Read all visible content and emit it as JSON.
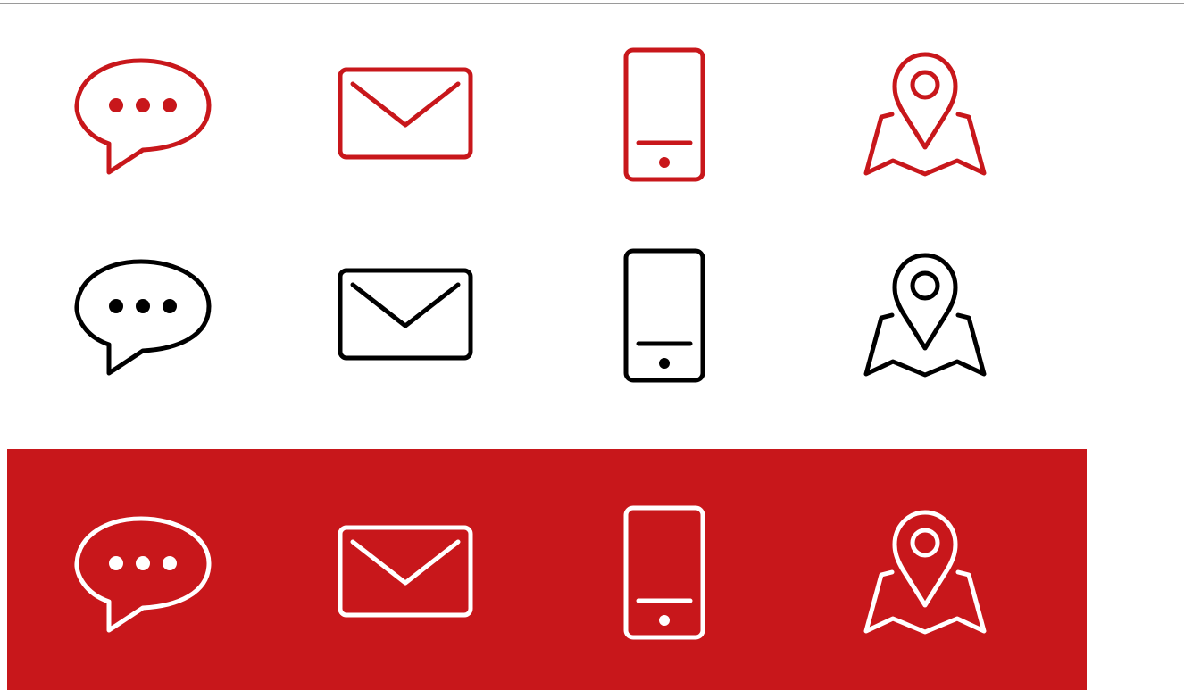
{
  "colors": {
    "red": "#c8171b",
    "black": "#000000",
    "white": "#ffffff",
    "banner_background": "#c8171b",
    "divider": "#9a9a9a"
  },
  "icon_rows": [
    {
      "variant": "red-outline-on-white",
      "stroke": "#c8171b",
      "icons": [
        "chat-bubble-icon",
        "envelope-icon",
        "smartphone-icon",
        "map-pin-icon"
      ]
    },
    {
      "variant": "black-outline-on-white",
      "stroke": "#000000",
      "icons": [
        "chat-bubble-icon",
        "envelope-icon",
        "smartphone-icon",
        "map-pin-icon"
      ]
    },
    {
      "variant": "white-outline-on-red",
      "stroke": "#ffffff",
      "icons": [
        "chat-bubble-icon",
        "envelope-icon",
        "smartphone-icon",
        "map-pin-icon"
      ]
    }
  ]
}
